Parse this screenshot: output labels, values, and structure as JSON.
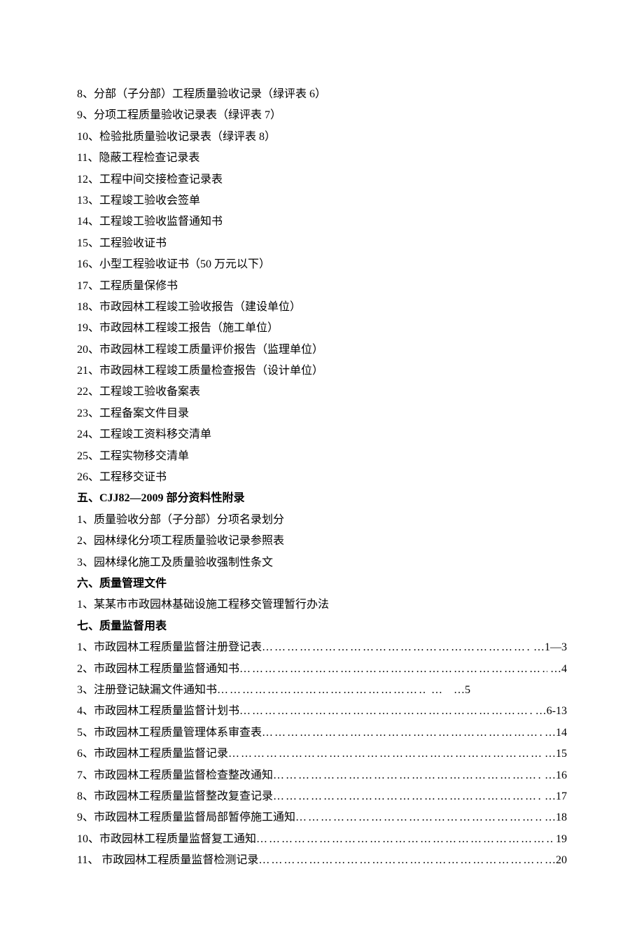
{
  "section4_items": [
    "8、分部（子分部）工程质量验收记录（绿评表 6）",
    "9、分项工程质量验收记录表（绿评表 7）",
    "10、检验批质量验收记录表（绿评表 8）",
    "11、隐蔽工程检查记录表",
    "12、工程中间交接检查记录表",
    "13、工程竣工验收会签单",
    "14、工程竣工验收监督通知书",
    "15、工程验收证书",
    "16、小型工程验收证书（50 万元以下）",
    "17、工程质量保修书",
    "18、市政园林工程竣工验收报告（建设单位）",
    "19、市政园林工程竣工报告（施工单位）",
    "20、市政园林工程竣工质量评价报告（监理单位）",
    "21、市政园林工程竣工质量检查报告（设计单位）",
    "22、工程竣工验收备案表",
    "23、工程备案文件目录",
    "24、工程竣工资料移交清单",
    "25、工程实物移交清单",
    "26、工程移交证书"
  ],
  "section5_heading": "五、CJJ82—2009 部分资料性附录",
  "section5_items": [
    "1、质量验收分部（子分部）分项名录划分",
    "2、园林绿化分项工程质量验收记录参照表",
    "3、园林绿化施工及质量验收强制性条文"
  ],
  "section6_heading": "六、质量管理文件",
  "section6_items": [
    "1、某某市市政园林基础设施工程移交管理暂行办法"
  ],
  "section7_heading": "七、质量监督用表",
  "section7_items": [
    {
      "label": "1、市政园林工程质量监督注册登记表",
      "leader": "dots",
      "page": "…1—3"
    },
    {
      "label": "2、市政园林工程质量监督通知书",
      "leader": "dots",
      "page": "…4"
    },
    {
      "label": "3、注册登记缺漏文件通知书",
      "leader": "dots-gap",
      "gap": "…　…5"
    },
    {
      "label": "4、市政园林工程质量监督计划书",
      "leader": "dots",
      "page": "…6-13"
    },
    {
      "label": "5、市政园林工程质量管理体系审查表",
      "leader": "dots",
      "page": "…14"
    },
    {
      "label": "6、市政园林工程质量监督记录",
      "leader": "dots",
      "page": "…15"
    },
    {
      "label": "7、市政园林工程质量监督检查整改通知",
      "leader": "dots",
      "page": "…16"
    },
    {
      "label": "8、市政园林工程质量监督整改复查记录",
      "leader": "dots",
      "page": "…17"
    },
    {
      "label": "9、市政园林工程质量监督局部暂停施工通知",
      "leader": "dots",
      "page": "…18"
    },
    {
      "label": "10、市政园林工程质量监督复工通知",
      "leader": "dots",
      "page": "19"
    },
    {
      "label": "11、 市政园林工程质量监督检测记录",
      "leader": "dots",
      "page": "…20"
    }
  ]
}
